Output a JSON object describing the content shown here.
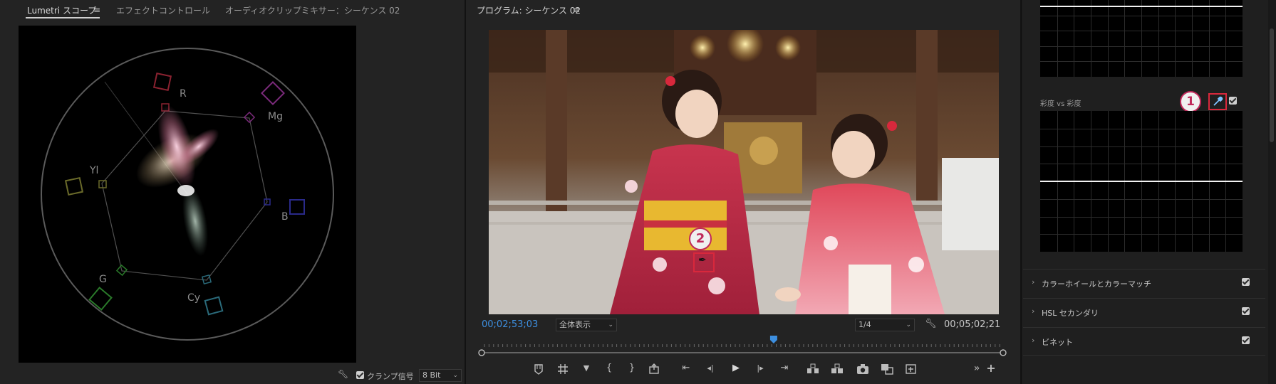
{
  "left_panel": {
    "tabs": [
      {
        "label": "Lumetri スコープ",
        "active": true
      },
      {
        "label": "エフェクトコントロール",
        "active": false
      },
      {
        "label": "オーディオクリップミキサー：シーケンス 02",
        "active": false
      }
    ],
    "menu_glyph": "≡",
    "scope": {
      "labels": {
        "r": "R",
        "mg": "Mg",
        "yl": "Yl",
        "b": "B",
        "g": "G",
        "cy": "Cy"
      },
      "colors": {
        "r": "#8a2230",
        "mg": "#7a2a7a",
        "yl": "#7a7a2a",
        "b": "#2a2a8a",
        "g": "#2a7a2a",
        "cy": "#2a6a7a"
      }
    },
    "bottom": {
      "clamp_label": "クランプ信号",
      "bit_depth": "8 Bit"
    }
  },
  "center_panel": {
    "title": "プログラム: シーケンス 02",
    "menu_glyph": "≡",
    "current_timecode": "00;02;53;03",
    "zoom_select": "全体表示",
    "resolution_select": "1/4",
    "duration_timecode": "00;05;02;21",
    "playhead_position": 0.56,
    "annotation_2": "2",
    "transport": {
      "marker": "▼",
      "in": "{",
      "out": "}",
      "goto_in": "⇤",
      "step_back": "◂|",
      "play": "▶",
      "step_fwd": "|▸",
      "goto_out": "⇥",
      "more": "»",
      "add": "+"
    }
  },
  "right_panel": {
    "curve_label": "彩度 vs 彩度",
    "annotation_1": "1",
    "sections": [
      {
        "label": "カラーホイールとカラーマッチ",
        "checked": true
      },
      {
        "label": "HSL セカンダリ",
        "checked": true
      },
      {
        "label": "ビネット",
        "checked": true
      }
    ],
    "accent_color": "#d8283c"
  }
}
